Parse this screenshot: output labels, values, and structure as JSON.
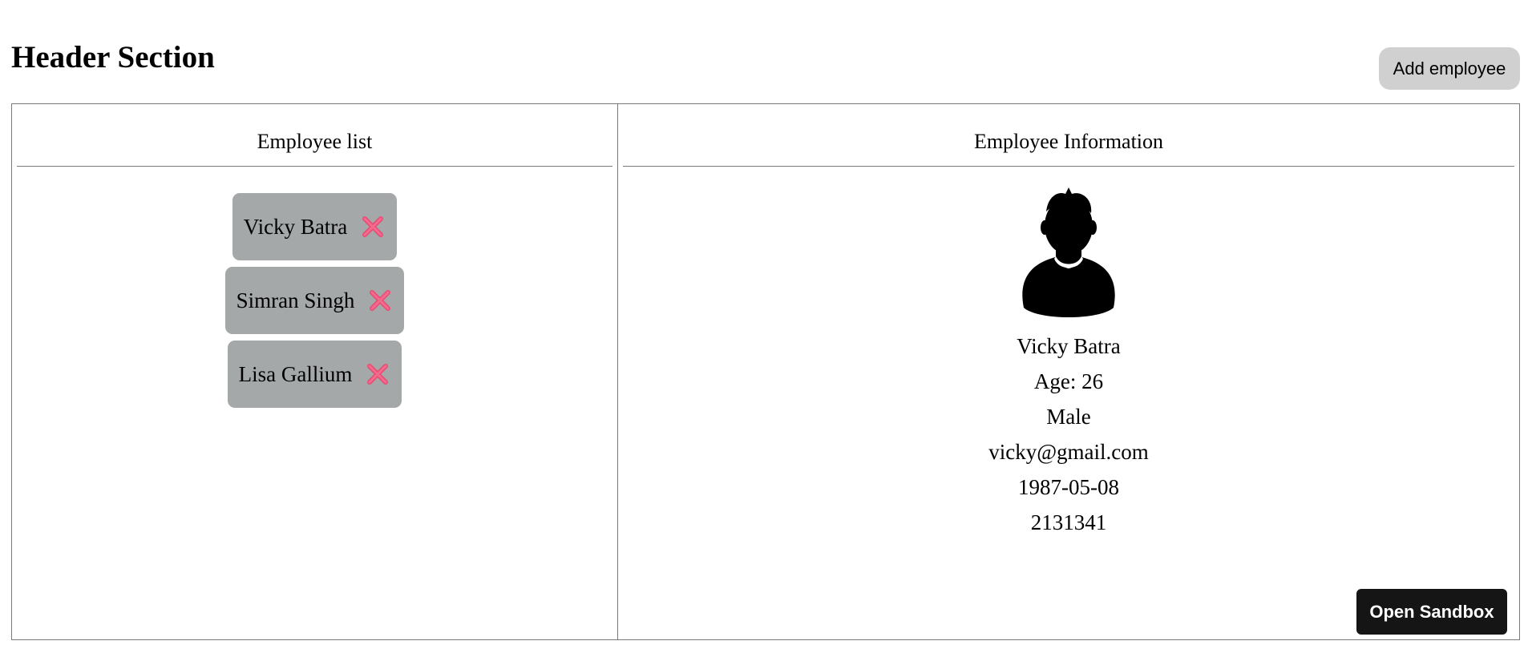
{
  "header": {
    "title": "Header Section",
    "add_button_label": "Add employee"
  },
  "list_panel": {
    "heading": "Employee list",
    "employees": [
      {
        "name": "Vicky Batra"
      },
      {
        "name": "Simran Singh"
      },
      {
        "name": "Lisa Gallium"
      }
    ],
    "delete_icon": "close-x-icon",
    "delete_icon_color": "#f0587f"
  },
  "info_panel": {
    "heading": "Employee Information",
    "avatar_icon": "user-avatar-icon",
    "name": "Vicky Batra",
    "age": "Age: 26",
    "gender": "Male",
    "email": "vicky@gmail.com",
    "dob": "1987-05-08",
    "phone": "2131341"
  },
  "sandbox_button_label": "Open Sandbox",
  "colors": {
    "item_bg": "#a4a8a8",
    "add_button_bg": "#d0d0d0",
    "sandbox_bg": "#151515",
    "border": "#7a7a7a"
  }
}
